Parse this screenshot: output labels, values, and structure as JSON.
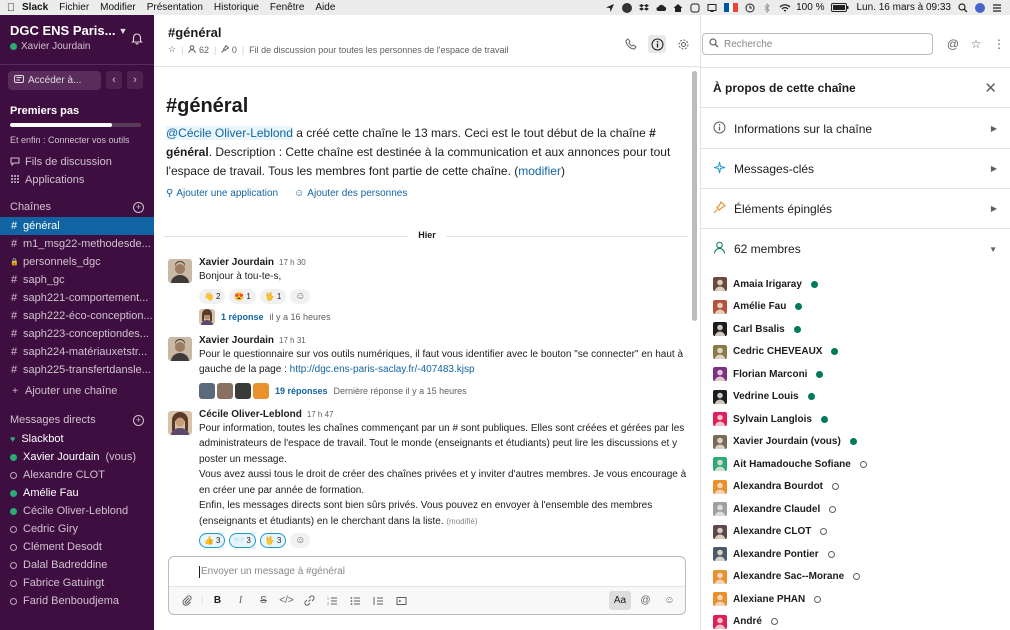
{
  "menubar": {
    "app": "Slack",
    "items": [
      "Fichier",
      "Modifier",
      "Présentation",
      "Historique",
      "Fenêtre",
      "Aide"
    ],
    "battery": "100 %",
    "clock": "Lun. 16 mars à 09:33"
  },
  "sidebar": {
    "workspace": "DGC ENS Paris...",
    "user": "Xavier Jourdain",
    "jump_label": "Accéder à...",
    "first_steps": {
      "title": "Premiers pas",
      "progress": 0.78,
      "subtitle": "Et enfin : Connecter vos outils"
    },
    "nav": [
      {
        "label": "Fils de discussion",
        "icon": "threads-icon"
      },
      {
        "label": "Applications",
        "icon": "apps-icon"
      }
    ],
    "channels_title": "Chaînes",
    "channels": [
      {
        "label": "général",
        "prefix": "#",
        "active": true
      },
      {
        "label": "m1_msg22-methodesde...",
        "prefix": "#",
        "active": false
      },
      {
        "label": "personnels_dgc",
        "prefix": "🔒",
        "active": false
      },
      {
        "label": "saph_gc",
        "prefix": "#",
        "active": false
      },
      {
        "label": "saph221-comportement...",
        "prefix": "#",
        "active": false
      },
      {
        "label": "saph222-éco-conception...",
        "prefix": "#",
        "active": false
      },
      {
        "label": "saph223-conceptiondes...",
        "prefix": "#",
        "active": false
      },
      {
        "label": "saph224-matériauxetstr...",
        "prefix": "#",
        "active": false
      },
      {
        "label": "saph225-transfertdansle...",
        "prefix": "#",
        "active": false
      }
    ],
    "add_channel": "Ajouter une chaîne",
    "dm_title": "Messages directs",
    "dms": [
      {
        "label": "Slackbot",
        "status": "heart",
        "bold": true,
        "suffix": ""
      },
      {
        "label": "Xavier Jourdain",
        "status": "online",
        "bold": true,
        "suffix": "(vous)"
      },
      {
        "label": "Alexandre CLOT",
        "status": "away",
        "bold": false,
        "suffix": ""
      },
      {
        "label": "Amélie Fau",
        "status": "online",
        "bold": true,
        "suffix": ""
      },
      {
        "label": "Cécile Oliver-Leblond",
        "status": "online",
        "bold": false,
        "suffix": ""
      },
      {
        "label": "Cedric Giry",
        "status": "away",
        "bold": false,
        "suffix": ""
      },
      {
        "label": "Clément Desodt",
        "status": "away",
        "bold": false,
        "suffix": ""
      },
      {
        "label": "Dalal Badreddine",
        "status": "away",
        "bold": false,
        "suffix": ""
      },
      {
        "label": "Fabrice Gatuingt",
        "status": "away",
        "bold": false,
        "suffix": ""
      },
      {
        "label": "Farid Benboudjema",
        "status": "away",
        "bold": false,
        "suffix": ""
      }
    ]
  },
  "channel": {
    "title": "#général",
    "members_count": "62",
    "pins_count": "0",
    "topic": "Fil de discussion pour toutes les personnes de l'espace de travail",
    "intro_title": "#général",
    "intro_mention": "@Cécile Oliver-Leblond",
    "intro_text_1": " a créé cette chaîne le 13 mars. Ceci est le tout début de la chaîne ",
    "intro_channel_ref": "# général",
    "intro_text_2": ". Description : Cette chaîne est destinée à la communication et aux annonces pour tout l'espace de travail. Tous les membres font partie de cette chaîne. (",
    "intro_edit_link": "modifier",
    "intro_text_3": ")",
    "add_app": "Ajouter une application",
    "add_people": "Ajouter des personnes",
    "day_divider": "Hier"
  },
  "messages": [
    {
      "author": "Xavier Jourdain",
      "time": "17 h 30",
      "text": "Bonjour à tou-te-s,",
      "reactions": [
        {
          "emoji": "👋",
          "count": "2",
          "mine": false
        },
        {
          "emoji": "😍",
          "count": "1",
          "mine": false
        },
        {
          "emoji": "🖖",
          "count": "1",
          "mine": false
        }
      ],
      "thread_count": "1 réponse",
      "thread_when": "il y a 16 heures"
    },
    {
      "author": "Xavier Jourdain",
      "time": "17 h 31",
      "text": "Pour le questionnaire sur vos outils numériques, il faut vous identifier avec le bouton \"se connecter\" en haut à gauche de la page : ",
      "link": "http://dgc.ens-paris-saclay.fr/-407483.kjsp",
      "thread_count": "19 réponses",
      "thread_when": "Dernière réponse il y a 15 heures"
    },
    {
      "author": "Cécile Oliver-Leblond",
      "time": "17 h 47",
      "para1": "Pour information, toutes les chaînes commençant par un # sont publiques. Elles sont créées et gérées par les administrateurs de l'espace de travail. Tout le monde (enseignants et étudiants) peut lire les discussions et y poster un message.",
      "para2": "Vous avez aussi tous le droit de créer des chaînes privées et y inviter d'autres membres. Je vous encourage à en créer une par année de formation.",
      "para3": "Enfin, les messages directs sont bien sûrs privés. Vous pouvez en envoyer à l'ensemble des membres (enseignants et étudiants) en le cherchant dans la liste.",
      "edited": "(modifié)",
      "reactions": [
        {
          "emoji": "👍",
          "count": "3",
          "mine": true
        },
        {
          "emoji": "📨",
          "count": "3",
          "mine": true
        },
        {
          "emoji": "🖖",
          "count": "3",
          "mine": true
        }
      ]
    }
  ],
  "composer": {
    "placeholder": "Envoyer un message à #général",
    "format_label": "Aa"
  },
  "search": {
    "placeholder": "Recherche"
  },
  "details": {
    "title": "À propos de cette chaîne",
    "rows": [
      {
        "label": "Informations sur la chaîne",
        "icon": "info-icon"
      },
      {
        "label": "Messages-clés",
        "icon": "sparkle-icon"
      },
      {
        "label": "Éléments épinglés",
        "icon": "pin-icon"
      }
    ],
    "members_label": "62 membres",
    "members": [
      {
        "name": "Amaia Irigaray",
        "online": true,
        "color": "#6b4a3a"
      },
      {
        "name": "Amélie Fau",
        "online": true,
        "color": "#b4523d"
      },
      {
        "name": "Carl Bsalis",
        "online": true,
        "color": "#1d1c1d"
      },
      {
        "name": "Cedric CHEVEAUX",
        "online": true,
        "color": "#8a7a4a"
      },
      {
        "name": "Florian Marconi",
        "online": true,
        "color": "#7c3085"
      },
      {
        "name": "Vedrine Louis",
        "online": true,
        "color": "#1d1c1d"
      },
      {
        "name": "Sylvain Langlois",
        "online": true,
        "color": "#e01e5a"
      },
      {
        "name": "Xavier Jourdain (vous)",
        "online": true,
        "color": "#7a6a5a"
      },
      {
        "name": "Ait Hamadouche Sofiane",
        "online": false,
        "color": "#2bac76"
      },
      {
        "name": "Alexandra Bourdot",
        "online": false,
        "color": "#e8912d"
      },
      {
        "name": "Alexandre Claudel",
        "online": false,
        "color": "#9e9ea6"
      },
      {
        "name": "Alexandre CLOT",
        "online": false,
        "color": "#5a4a4a"
      },
      {
        "name": "Alexandre Pontier",
        "online": false,
        "color": "#4a5a6a"
      },
      {
        "name": "Alexandre Sac--Morane",
        "online": false,
        "color": "#e8912d"
      },
      {
        "name": "Alexiane PHAN",
        "online": false,
        "color": "#e8912d"
      },
      {
        "name": "André",
        "online": false,
        "color": "#e01e5a"
      }
    ]
  },
  "colors": {
    "sidebar_bg": "#3f0e40",
    "active_channel": "#1164a3",
    "online": "#2bac76",
    "link": "#1264a3"
  }
}
